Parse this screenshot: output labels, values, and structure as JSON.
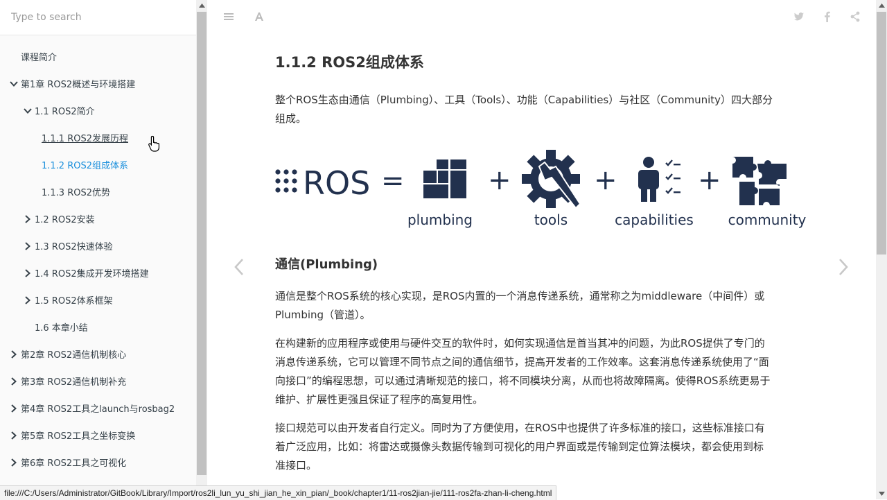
{
  "search": {
    "placeholder": "Type to search"
  },
  "toc": [
    {
      "label": "课程简介",
      "indent": 0,
      "chevron": "none"
    },
    {
      "label": "第1章 ROS2概述与环境搭建",
      "indent": 0,
      "chevron": "down"
    },
    {
      "label": "1.1 ROS2简介",
      "indent": 1,
      "chevron": "down"
    },
    {
      "label": "1.1.1 ROS2发展历程",
      "indent": 2,
      "chevron": "none",
      "state": "hover"
    },
    {
      "label": "1.1.2 ROS2组成体系",
      "indent": 2,
      "chevron": "none",
      "state": "active"
    },
    {
      "label": "1.1.3 ROS2优势",
      "indent": 2,
      "chevron": "none"
    },
    {
      "label": "1.2 ROS2安装",
      "indent": 1,
      "chevron": "right"
    },
    {
      "label": "1.3 ROS2快速体验",
      "indent": 1,
      "chevron": "right"
    },
    {
      "label": "1.4 ROS2集成开发环境搭建",
      "indent": 1,
      "chevron": "right"
    },
    {
      "label": "1.5 ROS2体系框架",
      "indent": 1,
      "chevron": "right"
    },
    {
      "label": "1.6 本章小结",
      "indent": 1,
      "chevron": "none"
    },
    {
      "label": "第2章 ROS2通信机制核心",
      "indent": 0,
      "chevron": "right"
    },
    {
      "label": "第3章 ROS2通信机制补充",
      "indent": 0,
      "chevron": "right"
    },
    {
      "label": "第4章 ROS2工具之launch与rosbag2",
      "indent": 0,
      "chevron": "right"
    },
    {
      "label": "第5章 ROS2工具之坐标变换",
      "indent": 0,
      "chevron": "right"
    },
    {
      "label": "第6章 ROS2工具之可视化",
      "indent": 0,
      "chevron": "right"
    }
  ],
  "page": {
    "title": "1.1.2 ROS2组成体系",
    "intro": "整个ROS生态由通信（Plumbing）、工具（Tools）、功能（Capabilities）与社区（Community）四大部分组成。",
    "intro_line1": "整个ROS生态由通信（Plumbing）、工具（Tools）、功能（Capabilities）与社区（Community）四大部分",
    "intro_line2": "组成。",
    "banner": {
      "ros_text": "ROS",
      "equals": "=",
      "plus": "+",
      "items": [
        "plumbing",
        "tools",
        "capabilities",
        "community"
      ],
      "color": "#22314e"
    },
    "section_heading": "通信(Plumbing)",
    "p1_line1": "通信是整个ROS系统的核心实现，是ROS内置的一个消息传递系统，通常称之为middleware（中间件）或",
    "p1_line2": "Plumbing（管道）。",
    "p2_line1": "在构建新的应用程序或使用与硬件交互的软件时，如何实现通信是首当其冲的问题，为此ROS提供了专门的",
    "p2_line2": "消息传递系统，它可以管理不同节点之间的通信细节，提高开发者的工作效率。这套消息传递系统使用了“面",
    "p2_line3": "向接口”的编程思想，可以通过清晰规范的接口，将不同模块分离，从而也将故障隔离。使得ROS系统更易于",
    "p2_line4": "维护、扩展性更强且保证了程序的高复用性。",
    "p3_line1": "接口规范可以由开发者自行定义。同时为了方便使用，在ROS中也提供了许多标准的接口，这些标准接口有",
    "p3_line2": "着广泛应用，比如：将雷达或摄像头数据传输到可视化的用户界面或是传输到定位算法模块，都会使用到标",
    "p3_line3": "准接口。"
  },
  "statusbar": {
    "url": "file:///C:/Users/Administrator/GitBook/Library/Import/ros2li_lun_yu_shi_jian_he_xin_pian/_book/chapter1/11-ros2jian-jie/111-ros2fa-zhan-li-cheng.html"
  },
  "colors": {
    "active": "#1a8fdc",
    "text": "#364149",
    "icon": "#bbbbbb"
  }
}
